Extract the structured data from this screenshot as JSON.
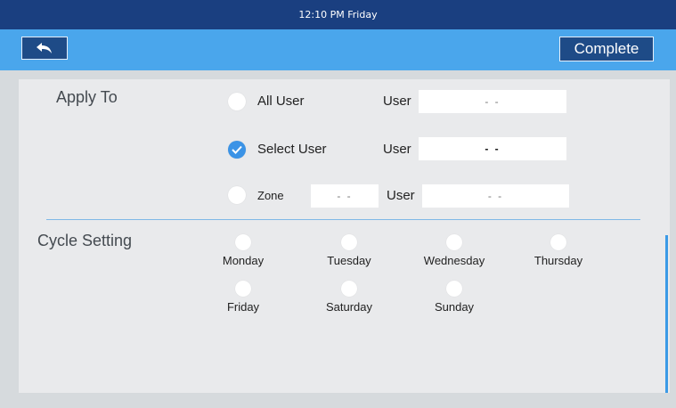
{
  "status_bar": {
    "time": "12:10 PM  Friday"
  },
  "toolbar": {
    "complete_label": "Complete"
  },
  "apply_to": {
    "title": "Apply To",
    "options": [
      {
        "label": "All User",
        "checked": false,
        "user_label": "User",
        "user_value": "- -"
      },
      {
        "label": "Select User",
        "checked": true,
        "user_label": "User",
        "user_value": "- -"
      },
      {
        "label": "Zone",
        "checked": false,
        "zone_value": "- -",
        "user_label": "User",
        "user_value": "- -"
      }
    ]
  },
  "cycle_setting": {
    "title": "Cycle Setting",
    "days": [
      "Monday",
      "Tuesday",
      "Wednesday",
      "Thursday",
      "Friday",
      "Saturday",
      "Sunday"
    ]
  },
  "colors": {
    "status_bar": "#1a3f80",
    "toolbar": "#4aa6ec",
    "button": "#1e4b87",
    "accent": "#3b93e6"
  },
  "icons": {
    "back": "back-arrow-icon",
    "check": "check-icon"
  }
}
